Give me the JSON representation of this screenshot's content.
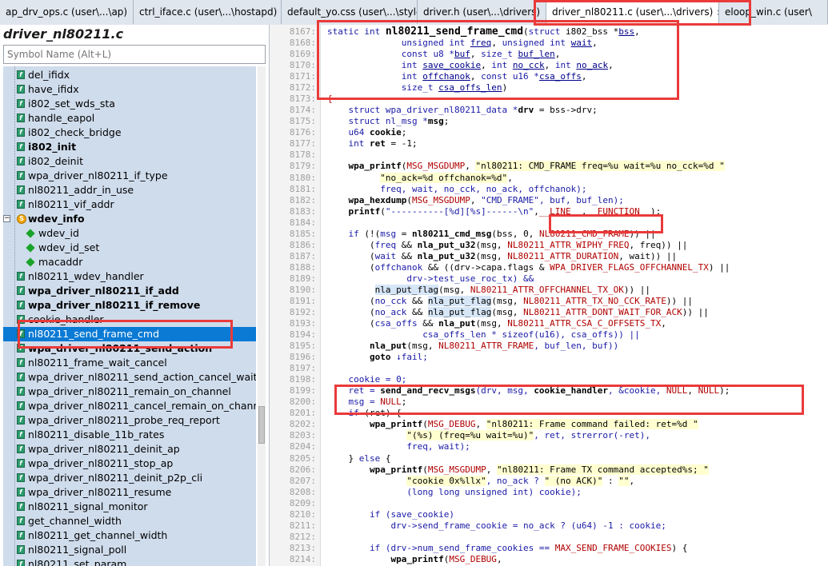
{
  "tabs": [
    {
      "label": "ap_drv_ops.c (user\\...\\ap)"
    },
    {
      "label": "ctrl_iface.c (user\\...\\hostapd)"
    },
    {
      "label": "default_yo.css (user\\...\\style)"
    },
    {
      "label": "driver.h (user\\...\\drivers)"
    },
    {
      "label": "driver_nl80211.c (user\\...\\drivers)",
      "active": true,
      "close": "×"
    },
    {
      "label": "eloop_win.c (user\\"
    }
  ],
  "left_panel": {
    "file_title": "driver_nl80211.c",
    "search_placeholder": "Symbol Name (Alt+L)",
    "tree": [
      {
        "label": "del_ifidx",
        "icon": "function-icon"
      },
      {
        "label": "have_ifidx",
        "icon": "function-icon"
      },
      {
        "label": "i802_set_wds_sta",
        "icon": "function-icon"
      },
      {
        "label": "handle_eapol",
        "icon": "function-icon"
      },
      {
        "label": "i802_check_bridge",
        "icon": "function-icon"
      },
      {
        "label": "i802_init",
        "icon": "function-icon",
        "bold": true
      },
      {
        "label": "i802_deinit",
        "icon": "function-icon"
      },
      {
        "label": "wpa_driver_nl80211_if_type",
        "icon": "function-icon"
      },
      {
        "label": "nl80211_addr_in_use",
        "icon": "function-icon"
      },
      {
        "label": "nl80211_vif_addr",
        "icon": "function-icon"
      },
      {
        "label": "wdev_info",
        "icon": "struct-icon",
        "bold": true,
        "expander": "−"
      },
      {
        "label": "wdev_id",
        "icon": "member-icon",
        "child": true
      },
      {
        "label": "wdev_id_set",
        "icon": "member-icon",
        "child": true
      },
      {
        "label": "macaddr",
        "icon": "member-icon",
        "child": true
      },
      {
        "label": "nl80211_wdev_handler",
        "icon": "function-icon"
      },
      {
        "label": "wpa_driver_nl80211_if_add",
        "icon": "function-icon",
        "bold": true
      },
      {
        "label": "wpa_driver_nl80211_if_remove",
        "icon": "function-icon",
        "bold": true
      },
      {
        "label": "cookie_handler",
        "icon": "function-icon"
      },
      {
        "label": "nl80211_send_frame_cmd",
        "icon": "function-icon",
        "selected": true
      },
      {
        "label": "wpa_driver_nl80211_send_action",
        "icon": "function-icon",
        "bold": true
      },
      {
        "label": "nl80211_frame_wait_cancel",
        "icon": "function-icon"
      },
      {
        "label": "wpa_driver_nl80211_send_action_cancel_wait",
        "icon": "function-icon"
      },
      {
        "label": "wpa_driver_nl80211_remain_on_channel",
        "icon": "function-icon"
      },
      {
        "label": "wpa_driver_nl80211_cancel_remain_on_channel",
        "icon": "function-icon"
      },
      {
        "label": "wpa_driver_nl80211_probe_req_report",
        "icon": "function-icon"
      },
      {
        "label": "nl80211_disable_11b_rates",
        "icon": "function-icon"
      },
      {
        "label": "wpa_driver_nl80211_deinit_ap",
        "icon": "function-icon"
      },
      {
        "label": "wpa_driver_nl80211_stop_ap",
        "icon": "function-icon"
      },
      {
        "label": "wpa_driver_nl80211_deinit_p2p_cli",
        "icon": "function-icon"
      },
      {
        "label": "wpa_driver_nl80211_resume",
        "icon": "function-icon"
      },
      {
        "label": "nl80211_signal_monitor",
        "icon": "function-icon"
      },
      {
        "label": "get_channel_width",
        "icon": "function-icon"
      },
      {
        "label": "nl80211_get_channel_width",
        "icon": "function-icon"
      },
      {
        "label": "nl80211_signal_poll",
        "icon": "function-icon"
      },
      {
        "label": "nl80211_set_param",
        "icon": "function-icon"
      }
    ]
  },
  "code_lines": [
    {
      "n": "8167:",
      "segs": [
        [
          "static int ",
          "kw"
        ],
        [
          "nl80211_send_frame_cmd",
          "bigfn"
        ],
        [
          "(",
          ""
        ],
        [
          "struct",
          "kw"
        ],
        [
          " i802_bss *",
          ""
        ],
        [
          "bss",
          "var"
        ],
        [
          ",",
          ""
        ]
      ]
    },
    {
      "n": "8168:",
      "segs": [
        [
          "              unsigned int ",
          "kw"
        ],
        [
          "freq",
          "var"
        ],
        [
          ", ",
          ""
        ],
        [
          "unsigned int ",
          "kw"
        ],
        [
          "wait",
          "var"
        ],
        [
          ",",
          ""
        ]
      ]
    },
    {
      "n": "8169:",
      "segs": [
        [
          "              const u8 *",
          "kw"
        ],
        [
          "buf",
          "var"
        ],
        [
          ", ",
          ""
        ],
        [
          "size_t ",
          "kw"
        ],
        [
          "buf_len",
          "var"
        ],
        [
          ",",
          ""
        ]
      ]
    },
    {
      "n": "8170:",
      "segs": [
        [
          "              int ",
          "kw"
        ],
        [
          "save_cookie",
          "var"
        ],
        [
          ", ",
          ""
        ],
        [
          "int ",
          "kw"
        ],
        [
          "no_cck",
          "var"
        ],
        [
          ", ",
          ""
        ],
        [
          "int ",
          "kw"
        ],
        [
          "no_ack",
          "var"
        ],
        [
          ",",
          ""
        ]
      ]
    },
    {
      "n": "8171:",
      "segs": [
        [
          "              int ",
          "kw"
        ],
        [
          "offchanok",
          "var"
        ],
        [
          ", ",
          ""
        ],
        [
          "const u16 *",
          "kw"
        ],
        [
          "csa_offs",
          "var"
        ],
        [
          ",",
          ""
        ]
      ]
    },
    {
      "n": "8172:",
      "segs": [
        [
          "              size_t ",
          "kw"
        ],
        [
          "csa_offs_len",
          "var"
        ],
        [
          ")",
          ""
        ]
      ]
    },
    {
      "n": "8173:",
      "segs": [
        [
          "{",
          "mac"
        ]
      ]
    },
    {
      "n": "8174:",
      "segs": [
        [
          "    struct ",
          "kw"
        ],
        [
          "wpa_driver_nl80211_data *",
          "kw"
        ],
        [
          "drv",
          "fn"
        ],
        [
          " = bss->drv;",
          ""
        ]
      ]
    },
    {
      "n": "8175:",
      "segs": [
        [
          "    struct ",
          "kw"
        ],
        [
          "nl_msg *",
          "kw"
        ],
        [
          "msg",
          "fn"
        ],
        [
          ";",
          ""
        ]
      ]
    },
    {
      "n": "8176:",
      "segs": [
        [
          "    u64 ",
          "kw"
        ],
        [
          "cookie",
          "fn"
        ],
        [
          ";",
          ""
        ]
      ]
    },
    {
      "n": "8177:",
      "segs": [
        [
          "    int ",
          "kw"
        ],
        [
          "ret",
          "fn"
        ],
        [
          " = -1;",
          ""
        ]
      ]
    },
    {
      "n": "8178:",
      "segs": [
        [
          "",
          ""
        ]
      ]
    },
    {
      "n": "8179:",
      "segs": [
        [
          "    wpa_printf",
          "fn"
        ],
        [
          "(",
          ""
        ],
        [
          "MSG_MSGDUMP",
          "mac"
        ],
        [
          ", ",
          ""
        ],
        [
          "\"nl80211: CMD_FRAME freq=%u wait=%u no_cck=%d \"",
          "str-hl"
        ]
      ]
    },
    {
      "n": "8180:",
      "segs": [
        [
          "          ",
          ""
        ],
        [
          "\"no_ack=%d offchanok=%d\"",
          "str-hl"
        ],
        [
          ",",
          ""
        ]
      ]
    },
    {
      "n": "8181:",
      "segs": [
        [
          "          freq, wait, no_cck, no_ack, offchanok);",
          "kw"
        ]
      ]
    },
    {
      "n": "8182:",
      "segs": [
        [
          "    wpa_hexdump",
          "fn"
        ],
        [
          "(",
          ""
        ],
        [
          "MSG_MSGDUMP",
          "mac"
        ],
        [
          ", ",
          ""
        ],
        [
          "\"CMD_FRAME\"",
          "str"
        ],
        [
          ", buf, buf_len);",
          "kw"
        ]
      ]
    },
    {
      "n": "8183:",
      "segs": [
        [
          "    printf",
          "fn"
        ],
        [
          "(",
          ""
        ],
        [
          "\"----------[%d][%s]------\\n\"",
          "str"
        ],
        [
          ",",
          ""
        ],
        [
          "__LINE__",
          "mac"
        ],
        [
          ",",
          ""
        ],
        [
          "__FUNCTION__",
          "mac"
        ],
        [
          ");",
          ""
        ]
      ]
    },
    {
      "n": "8184:",
      "segs": [
        [
          "",
          ""
        ]
      ]
    },
    {
      "n": "8185:",
      "segs": [
        [
          "    if",
          "kw"
        ],
        [
          " (!(",
          ""
        ],
        [
          "msg",
          "kw"
        ],
        [
          " = ",
          ""
        ],
        [
          "nl80211_cmd_msg",
          "fn"
        ],
        [
          "(bss, 0, ",
          ""
        ],
        [
          "NL80211_CMD_FRAME",
          "mac"
        ],
        [
          ")) ||",
          ""
        ]
      ]
    },
    {
      "n": "8186:",
      "segs": [
        [
          "        (",
          ""
        ],
        [
          "freq",
          "kw"
        ],
        [
          " && ",
          ""
        ],
        [
          "nla_put_u32",
          "fn"
        ],
        [
          "(msg, ",
          ""
        ],
        [
          "NL80211_ATTR_WIPHY_FREQ",
          "mac"
        ],
        [
          ", freq)) ||",
          ""
        ]
      ]
    },
    {
      "n": "8187:",
      "segs": [
        [
          "        (",
          ""
        ],
        [
          "wait",
          "kw"
        ],
        [
          " && ",
          ""
        ],
        [
          "nla_put_u32",
          "fn"
        ],
        [
          "(msg, ",
          ""
        ],
        [
          "NL80211_ATTR_DURATION",
          "mac"
        ],
        [
          ", wait)) ||",
          ""
        ]
      ]
    },
    {
      "n": "8188:",
      "segs": [
        [
          "        (",
          ""
        ],
        [
          "offchanok",
          "kw"
        ],
        [
          " && ((drv->capa.flags & ",
          ""
        ],
        [
          "WPA_DRIVER_FLAGS_OFFCHANNEL_TX",
          "mac"
        ],
        [
          ") ||",
          ""
        ]
      ]
    },
    {
      "n": "8189:",
      "segs": [
        [
          "               drv->test_use_roc_tx) &&",
          "kw"
        ]
      ]
    },
    {
      "n": "8190:",
      "segs": [
        [
          "         ",
          ""
        ],
        [
          "nla_put_flag",
          "hl"
        ],
        [
          "(msg, ",
          ""
        ],
        [
          "NL80211_ATTR_OFFCHANNEL_TX_OK",
          "mac"
        ],
        [
          ")) ||",
          ""
        ]
      ]
    },
    {
      "n": "8191:",
      "segs": [
        [
          "        (",
          ""
        ],
        [
          "no_cck",
          "kw"
        ],
        [
          " && ",
          ""
        ],
        [
          "nla_put_flag",
          "hl"
        ],
        [
          "(msg, ",
          ""
        ],
        [
          "NL80211_ATTR_TX_NO_CCK_RATE",
          "mac"
        ],
        [
          ")) ||",
          ""
        ]
      ]
    },
    {
      "n": "8192:",
      "segs": [
        [
          "        (",
          ""
        ],
        [
          "no_ack",
          "kw"
        ],
        [
          " && ",
          ""
        ],
        [
          "nla_put_flag",
          "hl"
        ],
        [
          "(msg, ",
          ""
        ],
        [
          "NL80211_ATTR_DONT_WAIT_FOR_ACK",
          "mac"
        ],
        [
          ")) ||",
          ""
        ]
      ]
    },
    {
      "n": "8193:",
      "segs": [
        [
          "        (",
          ""
        ],
        [
          "csa_offs",
          "kw"
        ],
        [
          " && ",
          ""
        ],
        [
          "nla_put",
          "fn"
        ],
        [
          "(msg, ",
          ""
        ],
        [
          "NL80211_ATTR_CSA_C_OFFSETS_TX",
          "mac"
        ],
        [
          ",",
          ""
        ]
      ]
    },
    {
      "n": "8194:",
      "segs": [
        [
          "                  csa_offs_len * sizeof(u16), csa_offs)) ||",
          "kw"
        ]
      ]
    },
    {
      "n": "8195:",
      "segs": [
        [
          "        ",
          ""
        ],
        [
          "nla_put",
          "fn"
        ],
        [
          "(msg, ",
          ""
        ],
        [
          "NL80211_ATTR_FRAME",
          "mac"
        ],
        [
          ", buf_len, buf))",
          "kw"
        ]
      ]
    },
    {
      "n": "8196:",
      "segs": [
        [
          "        goto ",
          "fn"
        ],
        [
          "↓fail;",
          "kw"
        ]
      ]
    },
    {
      "n": "8197:",
      "segs": [
        [
          "",
          ""
        ]
      ]
    },
    {
      "n": "8198:",
      "segs": [
        [
          "    cookie = 0;",
          "kw"
        ]
      ]
    },
    {
      "n": "8199:",
      "segs": [
        [
          "    ret = ",
          "kw"
        ],
        [
          "send_and_recv_msgs",
          "fn"
        ],
        [
          "(drv, msg, ",
          "kw"
        ],
        [
          "cookie_handler",
          "fn"
        ],
        [
          ", &cookie, ",
          "kw"
        ],
        [
          "NULL",
          "mac"
        ],
        [
          ", ",
          ""
        ],
        [
          "NULL",
          "mac"
        ],
        [
          ");",
          ""
        ]
      ]
    },
    {
      "n": "8200:",
      "segs": [
        [
          "    msg = ",
          "kw"
        ],
        [
          "NULL",
          "mac"
        ],
        [
          ";",
          ""
        ]
      ]
    },
    {
      "n": "8201:",
      "segs": [
        [
          "    if",
          "kw"
        ],
        [
          " (ret) {",
          ""
        ]
      ]
    },
    {
      "n": "8202:",
      "segs": [
        [
          "        wpa_printf",
          "fn"
        ],
        [
          "(",
          ""
        ],
        [
          "MSG_DEBUG",
          "mac"
        ],
        [
          ", ",
          ""
        ],
        [
          "\"nl80211: Frame command failed: ret=%d \"",
          "str-hl"
        ]
      ]
    },
    {
      "n": "8203:",
      "segs": [
        [
          "               ",
          ""
        ],
        [
          "\"(%s) (freq=%u wait=%u)\"",
          "str-hl"
        ],
        [
          ", ret, strerror(-ret),",
          "kw"
        ]
      ]
    },
    {
      "n": "8204:",
      "segs": [
        [
          "               freq, wait);",
          "kw"
        ]
      ]
    },
    {
      "n": "8205:",
      "segs": [
        [
          "    } ",
          ""
        ],
        [
          "else",
          "kw"
        ],
        [
          " {",
          ""
        ]
      ]
    },
    {
      "n": "8206:",
      "segs": [
        [
          "        wpa_printf",
          "fn"
        ],
        [
          "(",
          ""
        ],
        [
          "MSG_MSGDUMP",
          "mac"
        ],
        [
          ", ",
          ""
        ],
        [
          "\"nl80211: Frame TX command accepted%s; \"",
          "str-hl"
        ]
      ]
    },
    {
      "n": "8207:",
      "segs": [
        [
          "               ",
          ""
        ],
        [
          "\"cookie 0x%llx\"",
          "str-hl"
        ],
        [
          ", no_ack ? ",
          "kw"
        ],
        [
          "\" (no ACK)\"",
          "str-hl"
        ],
        [
          " : ",
          ""
        ],
        [
          "\"\"",
          "str-hl"
        ],
        [
          ",",
          ""
        ]
      ]
    },
    {
      "n": "8208:",
      "segs": [
        [
          "               (long long unsigned int) cookie);",
          "kw"
        ]
      ]
    },
    {
      "n": "8209:",
      "segs": [
        [
          "",
          ""
        ]
      ]
    },
    {
      "n": "8210:",
      "segs": [
        [
          "        if",
          "kw"
        ],
        [
          " (save_cookie)",
          "kw"
        ]
      ]
    },
    {
      "n": "8211:",
      "segs": [
        [
          "            drv->send_frame_cookie = no_ack ? (u64) -1 : cookie;",
          "kw"
        ]
      ]
    },
    {
      "n": "8212:",
      "segs": [
        [
          "",
          ""
        ]
      ]
    },
    {
      "n": "8213:",
      "segs": [
        [
          "        if",
          "kw"
        ],
        [
          " (drv->num_send_frame_cookies == ",
          "kw"
        ],
        [
          "MAX_SEND_FRAME_COOKIES",
          "mac"
        ],
        [
          ") {",
          ""
        ]
      ]
    },
    {
      "n": "8214:",
      "segs": [
        [
          "            wpa_printf",
          "fn"
        ],
        [
          "(",
          ""
        ],
        [
          "MSG_DEBUG",
          "mac"
        ],
        [
          ",",
          ""
        ]
      ]
    }
  ],
  "colors": {
    "annotation_red": "#ea3a3a",
    "selection_blue": "#0a7ad4",
    "tree_bg": "#cfdcec"
  }
}
